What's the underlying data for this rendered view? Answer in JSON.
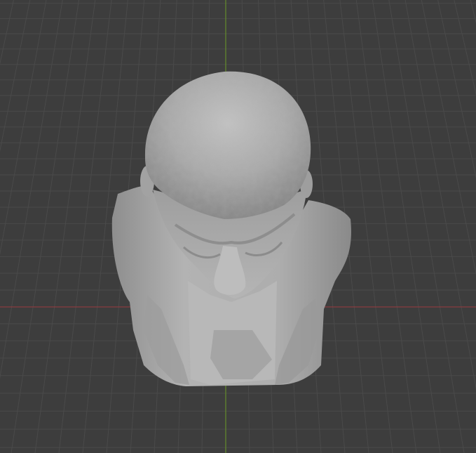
{
  "viewport": {
    "kind": "3d-viewport",
    "view": "top",
    "background_color": "#3d3d3d",
    "grid": {
      "visible": true,
      "line_color": "#4a4a4a",
      "minor_line_color": "#454545"
    },
    "axes": {
      "x_axis": {
        "visible": true,
        "color": "#9b3a3f"
      },
      "y_axis": {
        "visible": true,
        "color": "#6a9a26"
      }
    },
    "object": {
      "name": "bust",
      "description_icon": "sculpted-head-mesh",
      "material_color": "#a6a6a6"
    }
  }
}
